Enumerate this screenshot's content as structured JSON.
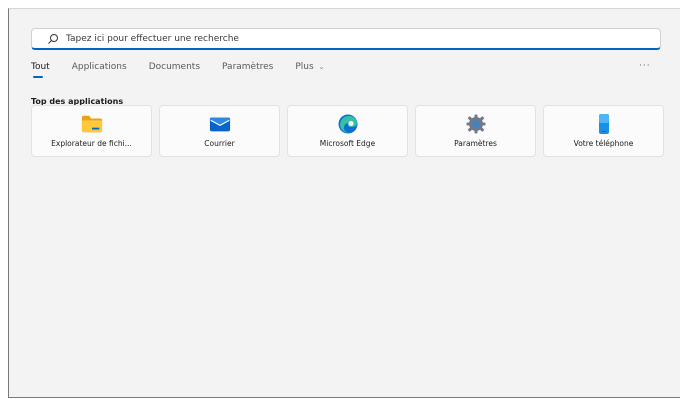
{
  "search": {
    "placeholder": "Tapez ici pour effectuer une recherche",
    "value": ""
  },
  "tabs": [
    {
      "label": "Tout",
      "active": true
    },
    {
      "label": "Applications",
      "active": false
    },
    {
      "label": "Documents",
      "active": false
    },
    {
      "label": "Paramètres",
      "active": false
    },
    {
      "label": "Plus",
      "active": false,
      "has_dropdown": true
    }
  ],
  "more_label": "···",
  "section_title": "Top des applications",
  "apps": [
    {
      "label": "Explorateur de fichi...",
      "icon": "folder-icon"
    },
    {
      "label": "Courrier",
      "icon": "mail-icon"
    },
    {
      "label": "Microsoft Edge",
      "icon": "edge-icon"
    },
    {
      "label": "Paramètres",
      "icon": "gear-icon"
    },
    {
      "label": "Votre téléphone",
      "icon": "phone-icon"
    }
  ],
  "colors": {
    "accent": "#0067c0",
    "panel_bg": "#f3f3f3"
  }
}
